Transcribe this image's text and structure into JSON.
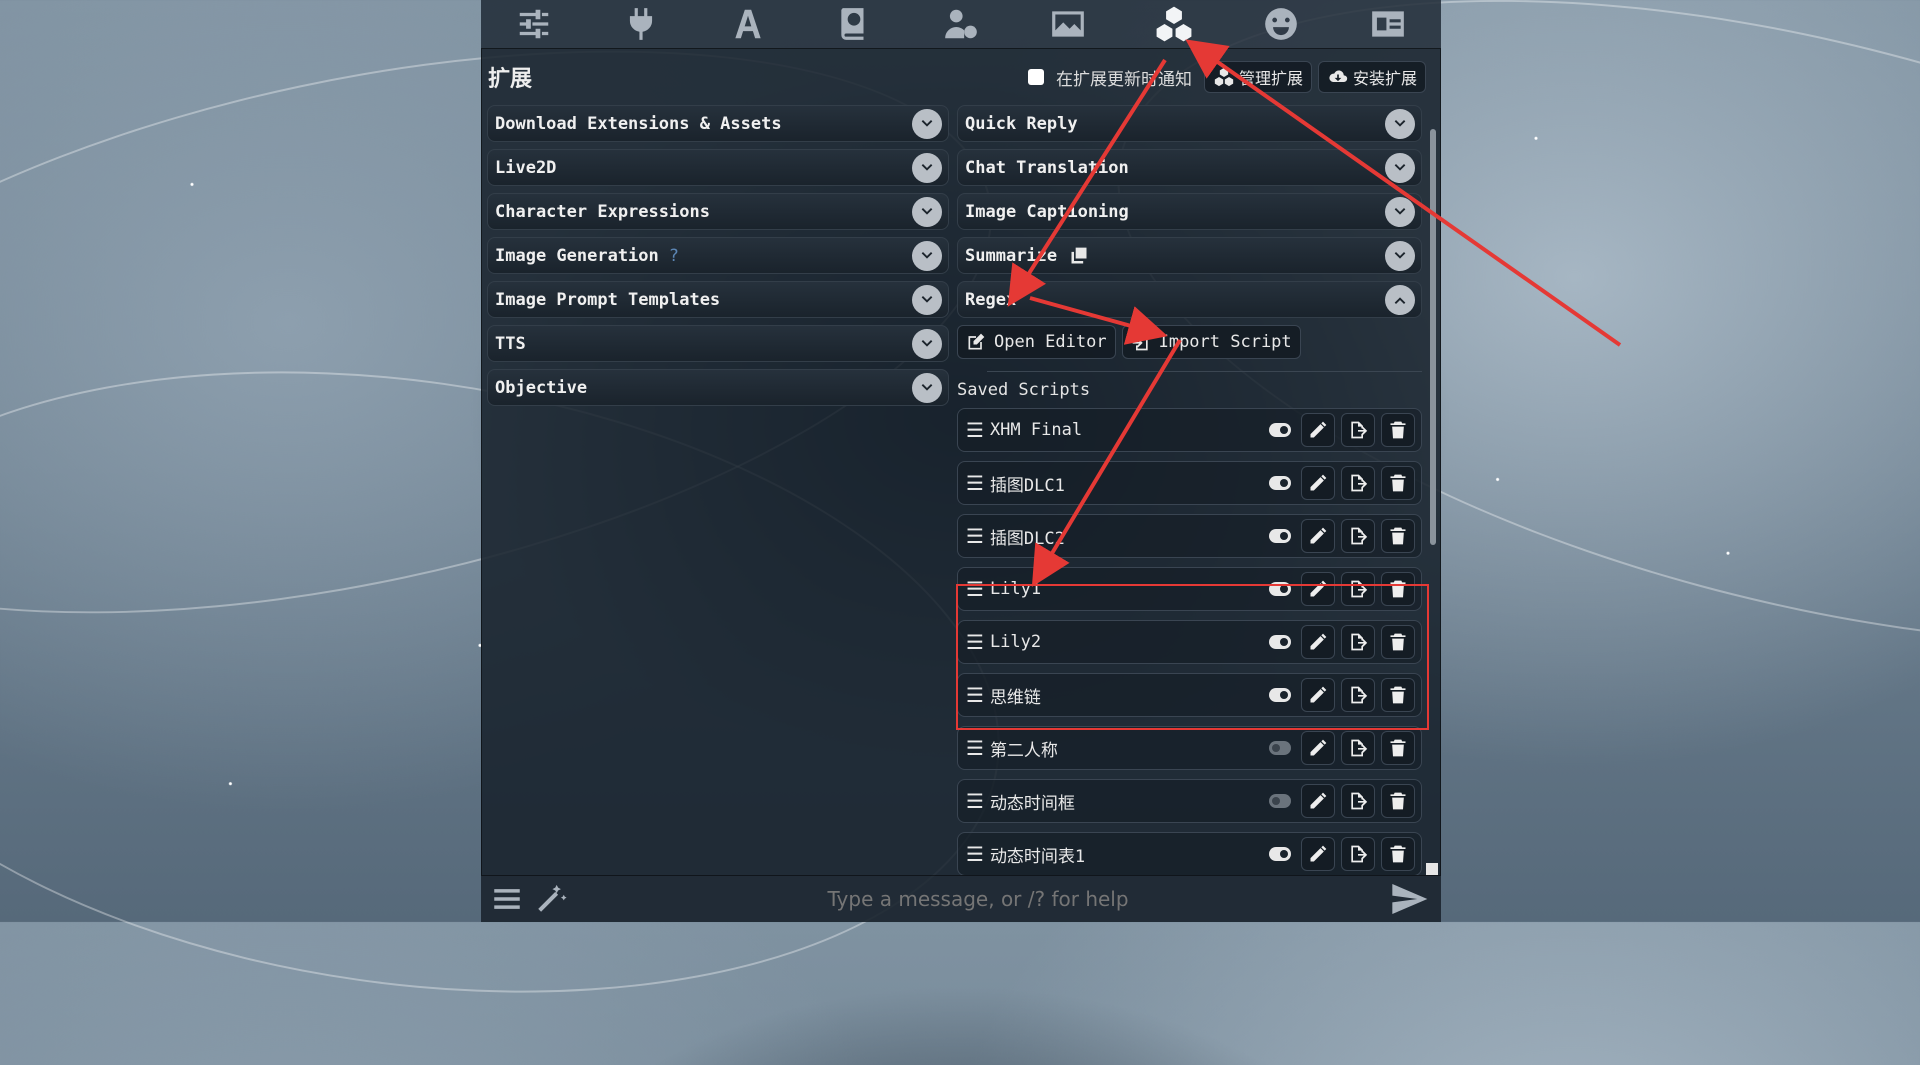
{
  "background": {
    "accent": "#7f92a1"
  },
  "topnav": {
    "icons": [
      {
        "name": "sliders-icon"
      },
      {
        "name": "plug-icon"
      },
      {
        "name": "font-icon"
      },
      {
        "name": "book-globe-icon"
      },
      {
        "name": "user-gear-icon"
      },
      {
        "name": "image-icon"
      },
      {
        "name": "cubes-icon",
        "active": true
      },
      {
        "name": "smile-icon"
      },
      {
        "name": "id-card-icon"
      }
    ]
  },
  "panel": {
    "title": "扩展",
    "notify_label": "在扩展更新时通知",
    "manage_label": "管理扩展",
    "install_label": "安装扩展"
  },
  "left_drawers": [
    {
      "label": "Download Extensions & Assets"
    },
    {
      "label": "Live2D"
    },
    {
      "label": "Character Expressions"
    },
    {
      "label": "Image Generation",
      "help": "?"
    },
    {
      "label": "Image Prompt Templates"
    },
    {
      "label": "TTS"
    },
    {
      "label": "Objective"
    }
  ],
  "right_drawers": [
    {
      "label": "Quick Reply"
    },
    {
      "label": "Chat Translation"
    },
    {
      "label": "Image Captioning"
    },
    {
      "label": "Summarize"
    },
    {
      "label": "Regex",
      "expanded": true
    }
  ],
  "regex": {
    "open_editor": "Open Editor",
    "import_script": "Import Script",
    "saved_label": "Saved Scripts",
    "scripts": [
      {
        "name": "XHM Final",
        "enabled": true
      },
      {
        "name": "插图DLC1",
        "enabled": true
      },
      {
        "name": "插图DLC2",
        "enabled": true
      },
      {
        "name": "Lily1",
        "enabled": true
      },
      {
        "name": "Lily2",
        "enabled": true
      },
      {
        "name": "思维链",
        "enabled": true
      },
      {
        "name": "第二人称",
        "enabled": false
      },
      {
        "name": "动态时间框",
        "enabled": false
      },
      {
        "name": "动态时间表1",
        "enabled": true
      }
    ]
  },
  "bottombar": {
    "placeholder": "Type a message, or /? for help"
  },
  "annotation": {
    "color": "#e53935"
  }
}
